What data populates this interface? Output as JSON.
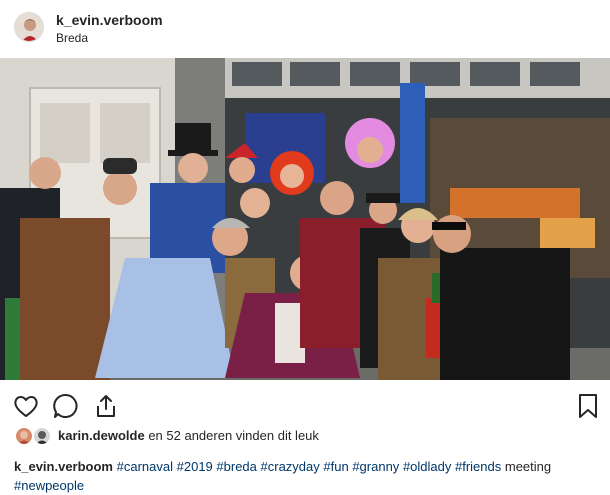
{
  "post": {
    "username": "k_evin.verboom",
    "location": "Breda",
    "photo_alt": "Group photo"
  },
  "actions": {
    "like_icon": "heart-icon",
    "comment_icon": "comment-icon",
    "share_icon": "share-icon",
    "save_icon": "bookmark-icon"
  },
  "likes": {
    "first_liker": "karin.dewolde",
    "rest": "en 52 anderen vinden dit leuk"
  },
  "caption": {
    "username": "k_evin.verboom",
    "tags": [
      "#carnaval",
      "#2019",
      "#breda",
      "#crazyday",
      "#fun",
      "#granny",
      "#oldlady",
      "#friends"
    ],
    "word": "meeting",
    "tag_last": "#newpeople"
  },
  "colors": {
    "text": "#262626",
    "hashtag": "#00376b",
    "border": "#dbdbdb"
  }
}
